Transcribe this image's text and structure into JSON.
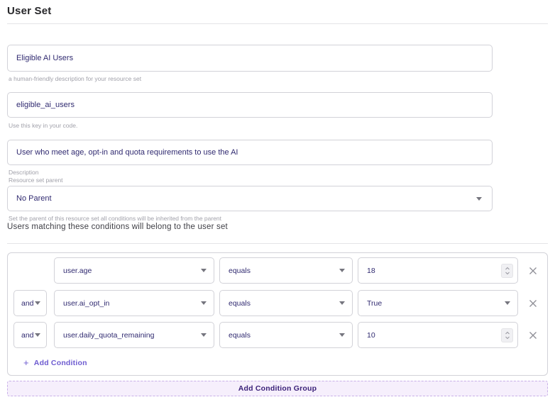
{
  "page": {
    "title": "User Set"
  },
  "fields": {
    "name": {
      "value": "Eligible AI Users",
      "helper": "a human-friendly description for your resource set"
    },
    "key": {
      "value": "eligible_ai_users",
      "helper": "Use this key in your code."
    },
    "description": {
      "value": "User who meet age, opt-in and quota requirements to use the AI",
      "label": "Description"
    },
    "parent": {
      "label": "Resource set parent",
      "value": "No Parent",
      "helper": "Set the parent of this resource set all conditions will be inherited from the parent"
    }
  },
  "conditions": {
    "heading": "Users matching these conditions will belong to the user set",
    "rows": [
      {
        "combinator": "",
        "property": "user.age",
        "operator": "equals",
        "value": "18",
        "value_kind": "number"
      },
      {
        "combinator": "and",
        "property": "user.ai_opt_in",
        "operator": "equals",
        "value": "True",
        "value_kind": "select"
      },
      {
        "combinator": "and",
        "property": "user.daily_quota_remaining",
        "operator": "equals",
        "value": "10",
        "value_kind": "number"
      }
    ],
    "add_condition_plus": "+",
    "add_condition_label": "Add Condition",
    "add_group_label": "Add Condition Group"
  },
  "colors": {
    "accent_purple": "#6d5bd0",
    "button_text": "#3b2179",
    "button_bg": "#f6effc",
    "button_border": "#c9b0e8",
    "input_text": "#302a70",
    "helper_text": "#a1a1aa",
    "border": "#d2d2d8",
    "title_text": "#27272a",
    "heading_text": "#3f3f46",
    "icon_gray": "#8e8e96"
  }
}
